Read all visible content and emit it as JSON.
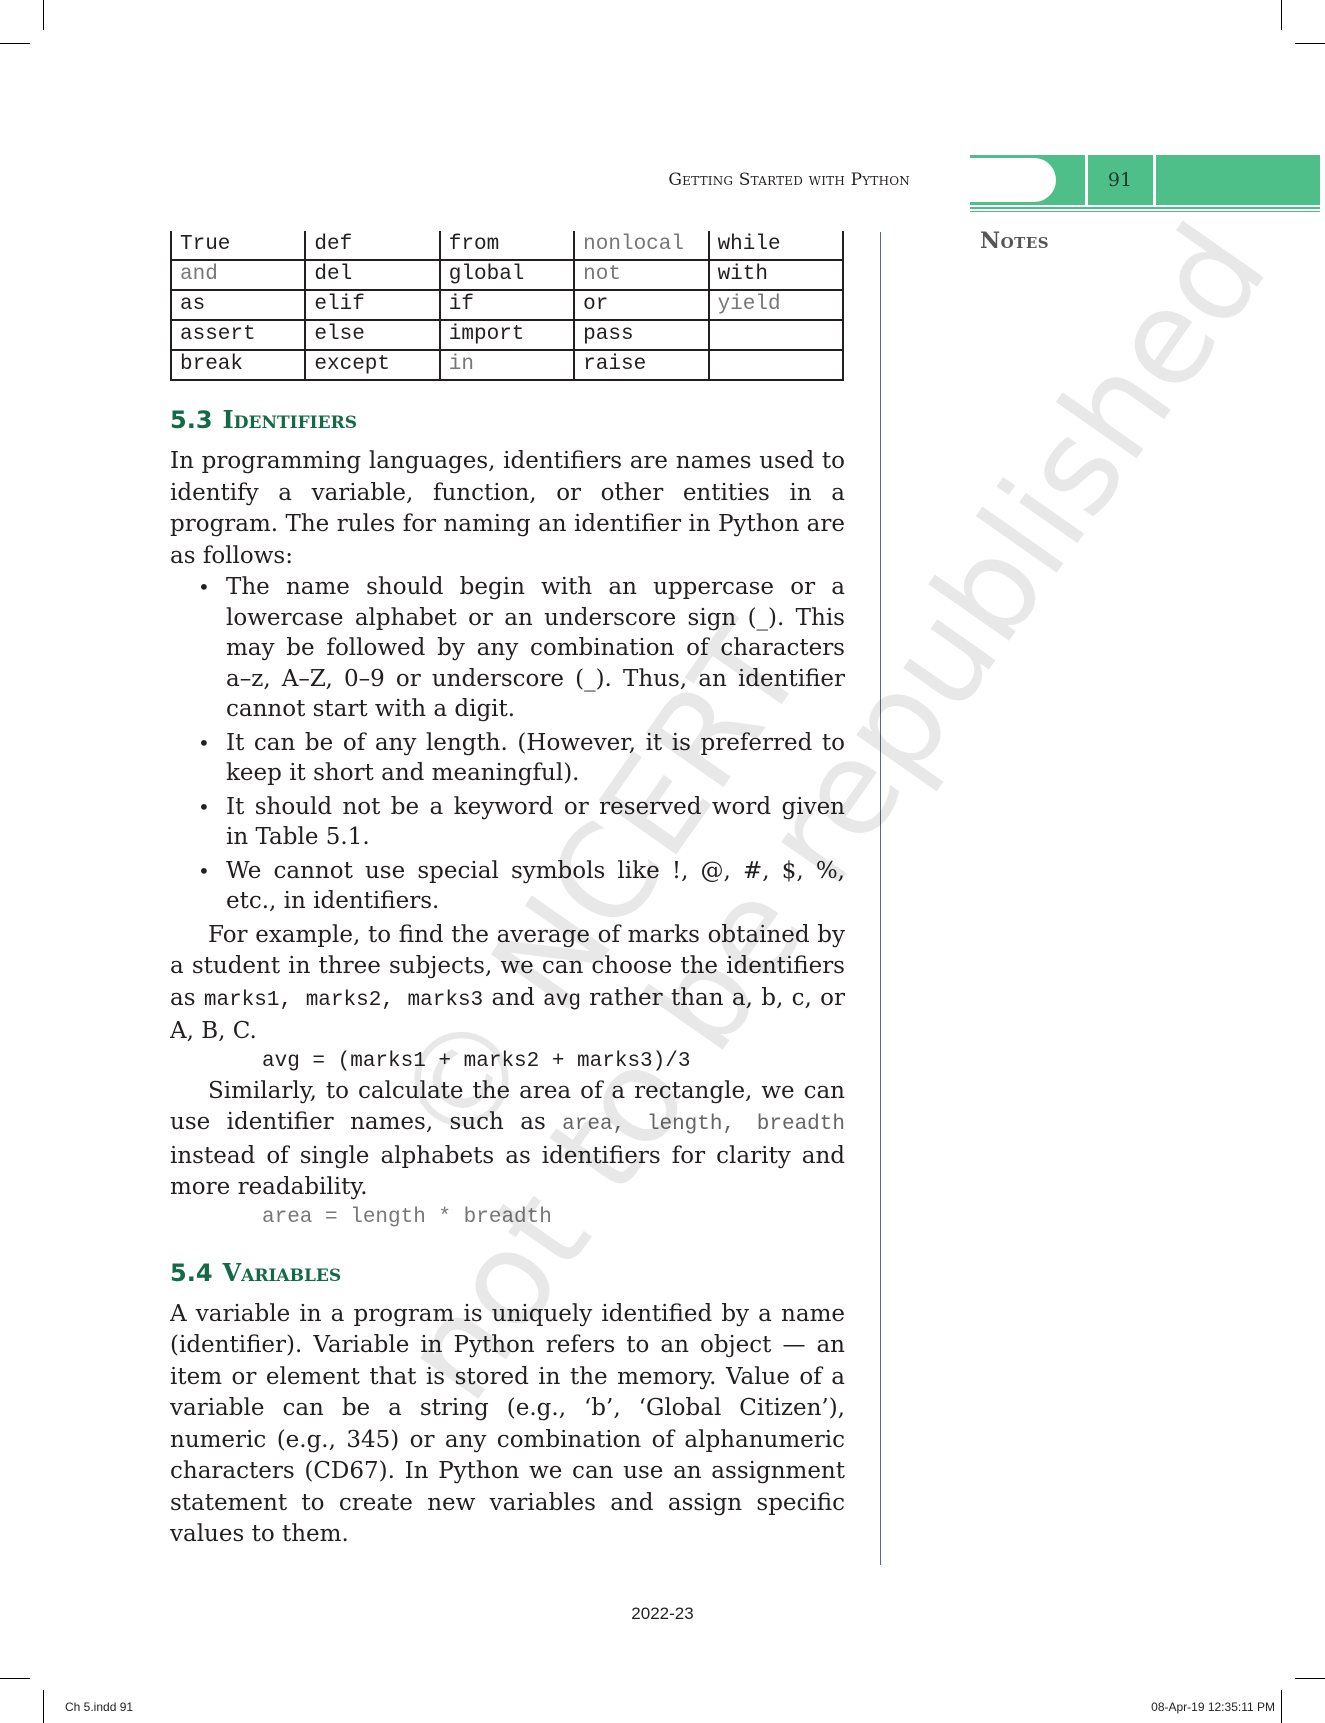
{
  "header": {
    "running_head": "Getting Started with Python",
    "page_number": "91",
    "accent_color": "#4fbf8a"
  },
  "margin": {
    "notes_label": "Notes"
  },
  "keyword_table": {
    "rows": [
      [
        {
          "text": "True",
          "light": false
        },
        {
          "text": "def",
          "light": false
        },
        {
          "text": "from",
          "light": false
        },
        {
          "text": "nonlocal",
          "light": true
        },
        {
          "text": "while",
          "light": false
        }
      ],
      [
        {
          "text": "and",
          "light": true
        },
        {
          "text": "del",
          "light": false
        },
        {
          "text": "global",
          "light": false
        },
        {
          "text": "not",
          "light": true
        },
        {
          "text": "with",
          "light": false
        }
      ],
      [
        {
          "text": "as",
          "light": false
        },
        {
          "text": "elif",
          "light": false
        },
        {
          "text": "if",
          "light": false
        },
        {
          "text": "or",
          "light": false
        },
        {
          "text": "yield",
          "light": true
        }
      ],
      [
        {
          "text": "assert",
          "light": false
        },
        {
          "text": "else",
          "light": false
        },
        {
          "text": "import",
          "light": false
        },
        {
          "text": "pass",
          "light": false
        },
        {
          "text": "",
          "light": false
        }
      ],
      [
        {
          "text": "break",
          "light": false
        },
        {
          "text": "except",
          "light": false
        },
        {
          "text": "in",
          "light": true
        },
        {
          "text": "raise",
          "light": false
        },
        {
          "text": "",
          "light": false
        }
      ]
    ]
  },
  "section_5_3": {
    "number": "5.3",
    "title": "Identifiers",
    "intro": "In programming languages, identifiers are names used to identify a variable, function, or other entities in a program. The rules for naming an identifier in Python are as follows:",
    "rules": [
      "The name should begin with an uppercase or a lowercase alphabet or an underscore sign (_). This may be followed by any combination of characters a–z, A–Z, 0–9 or underscore (_). Thus, an identifier cannot start with a digit.",
      "It can be of any length. (However, it is preferred to keep it short and meaningful).",
      "It should not be a keyword or reserved word given in Table 5.1.",
      "We cannot use special symbols like !, @, #, $, %, etc., in identifiers."
    ],
    "example1": {
      "before": "For example, to find the average of marks obtained by a student in three subjects, we can choose the identifiers as ",
      "code1": "marks1, marks2, marks3",
      "middle": " and ",
      "code2": "avg",
      "after": " rather than a, b, c, or A, B, C."
    },
    "code_line1": "avg = (marks1 + marks2 + marks3)/3",
    "example2": {
      "before": "Similarly, to calculate the area of a rectangle, we can use identifier names, such as ",
      "code": "area, length, breadth",
      "after": " instead of single alphabets as identifiers for clarity and more readability."
    },
    "code_line2": "area = length * breadth"
  },
  "section_5_4": {
    "number": "5.4",
    "title": "Variables",
    "paragraph": "A variable in a program is uniquely identified by a name (identifier). Variable in Python refers to an object — an item or element that is stored in the memory. Value of a variable can be a string (e.g., ‘b’, ‘Global Citizen’), numeric (e.g., 345) or any combination of alphanumeric characters (CD67). In Python we can use an assignment statement to create new variables and assign specific values to them."
  },
  "watermark": {
    "line1": "© NCERT",
    "line2": "not to be republished"
  },
  "footer": {
    "year": "2022-23",
    "slug_left": "Ch 5.indd   91",
    "slug_right": "08-Apr-19   12:35:11 PM"
  }
}
